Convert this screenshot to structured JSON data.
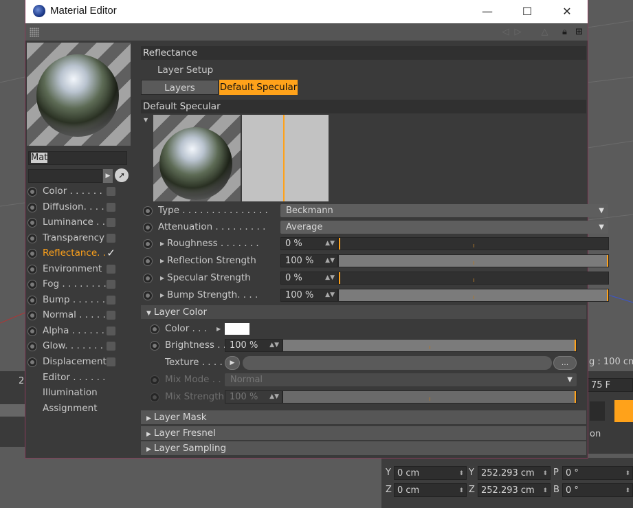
{
  "window": {
    "title": "Material Editor",
    "minimize": "—",
    "maximize": "☐",
    "close": "✕"
  },
  "material": {
    "name": "Mat"
  },
  "channels": [
    {
      "label": "Color . . . . . .",
      "checked": false
    },
    {
      "label": "Diffusion. . . .",
      "checked": false
    },
    {
      "label": "Luminance . .",
      "checked": false
    },
    {
      "label": "Transparency",
      "checked": false
    },
    {
      "label": "Reflectance. .",
      "checked": true,
      "active": true
    },
    {
      "label": "Environment",
      "checked": false
    },
    {
      "label": "Fog . . . . . . . .",
      "checked": false
    },
    {
      "label": "Bump . . . . . .",
      "checked": false
    },
    {
      "label": "Normal . . . . .",
      "checked": false
    },
    {
      "label": "Alpha . . . . . .",
      "checked": false
    },
    {
      "label": "Glow. . . . . . .",
      "checked": false
    },
    {
      "label": "Displacement",
      "checked": false
    }
  ],
  "extra_items": [
    "Editor . . . . . .",
    "Illumination",
    "Assignment"
  ],
  "reflectance": {
    "header": "Reflectance",
    "layer_setup": "Layer Setup",
    "tabs": [
      "Layers",
      "Default Specular"
    ],
    "layer_header": "Default Specular",
    "type_label": "Type . . . . . . . . . . . . . . .",
    "type_value": "Beckmann",
    "attenuation_label": "Attenuation . . . . . . . . .",
    "attenuation_value": "Average",
    "roughness_label": "Roughness . . . . . . .",
    "roughness_value": "0 %",
    "roughness_level": 0,
    "refl_strength_label": "Reflection Strength",
    "refl_strength_value": "100 %",
    "refl_strength_level": 1,
    "spec_strength_label": "Specular Strength",
    "spec_strength_value": "0 %",
    "spec_strength_level": 0,
    "bump_strength_label": "Bump Strength. . . .",
    "bump_strength_value": "100 %",
    "bump_strength_level": 1
  },
  "layer_color": {
    "header": "Layer Color",
    "color_label": "Color . . .",
    "color_value": "#ffffff",
    "brightness_label": "Brightness . .",
    "brightness_value": "100 %",
    "brightness_level": 1,
    "texture_label": "Texture . . . . .",
    "texture_more": "...",
    "mix_mode_label": "Mix Mode . .",
    "mix_mode_value": "Normal",
    "mix_strength_label": "Mix Strength",
    "mix_strength_value": "100 %"
  },
  "collapsed_sections": [
    "Layer Mask",
    "Layer Fresnel",
    "Layer Sampling"
  ],
  "background": {
    "scale_text": "g : 100 cm",
    "frame_text": "75 F",
    "on_text": "on",
    "num_2": "2",
    "coords": [
      {
        "axis": "Y",
        "pos": "0 cm",
        "axis2": "Y",
        "size": "252.293 cm",
        "axis3": "P",
        "rot": "0 °"
      },
      {
        "axis": "Z",
        "pos": "0 cm",
        "axis2": "Z",
        "size": "252.293 cm",
        "axis3": "B",
        "rot": "0 °"
      }
    ]
  },
  "colors": {
    "accent": "#ffa21a",
    "window_bg": "#3a3a3a",
    "frame_border": "#8a3b5b"
  }
}
